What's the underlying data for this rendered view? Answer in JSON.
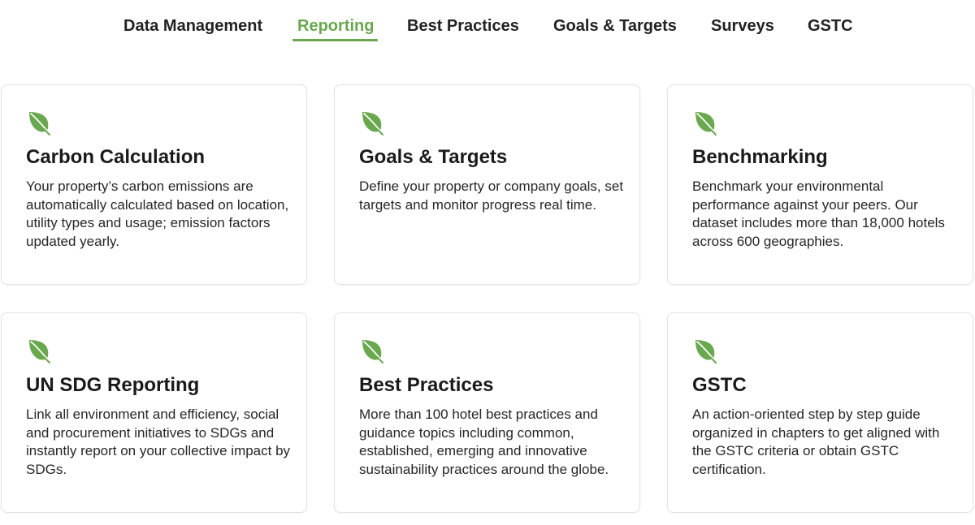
{
  "nav": {
    "tabs": [
      {
        "label": "Data Management",
        "active": false
      },
      {
        "label": "Reporting",
        "active": true
      },
      {
        "label": "Best Practices",
        "active": false
      },
      {
        "label": "Goals & Targets",
        "active": false
      },
      {
        "label": "Surveys",
        "active": false
      },
      {
        "label": "GSTC",
        "active": false
      }
    ]
  },
  "colors": {
    "accent": "#6aa84f",
    "text": "#222222",
    "border": "#e2e2e2"
  },
  "cards": [
    {
      "icon": "leaf-icon",
      "title": "Carbon Calculation",
      "description": "Your property’s carbon emissions are automatically calculated based on location, utility types and usage; emission factors updated yearly."
    },
    {
      "icon": "leaf-icon",
      "title": "Goals & Targets",
      "description": "Define your property or company goals, set targets and monitor progress real time."
    },
    {
      "icon": "leaf-icon",
      "title": "Benchmarking",
      "description": "Benchmark your environmental performance against your peers. Our dataset includes more than 18,000 hotels across 600 geographies."
    },
    {
      "icon": "leaf-icon",
      "title": "UN SDG Reporting",
      "description": "Link all environment and efficiency, social and procurement initiatives to SDGs and instantly report on your collective impact by SDGs."
    },
    {
      "icon": "leaf-icon",
      "title": "Best Practices",
      "description": "More than 100 hotel best practices and guidance topics including common, established, emerging and innovative sustainability practices around the globe."
    },
    {
      "icon": "leaf-icon",
      "title": "GSTC",
      "description": "An action-oriented step by step guide organized in chapters to get aligned with the GSTC criteria or obtain GSTC certification."
    }
  ]
}
